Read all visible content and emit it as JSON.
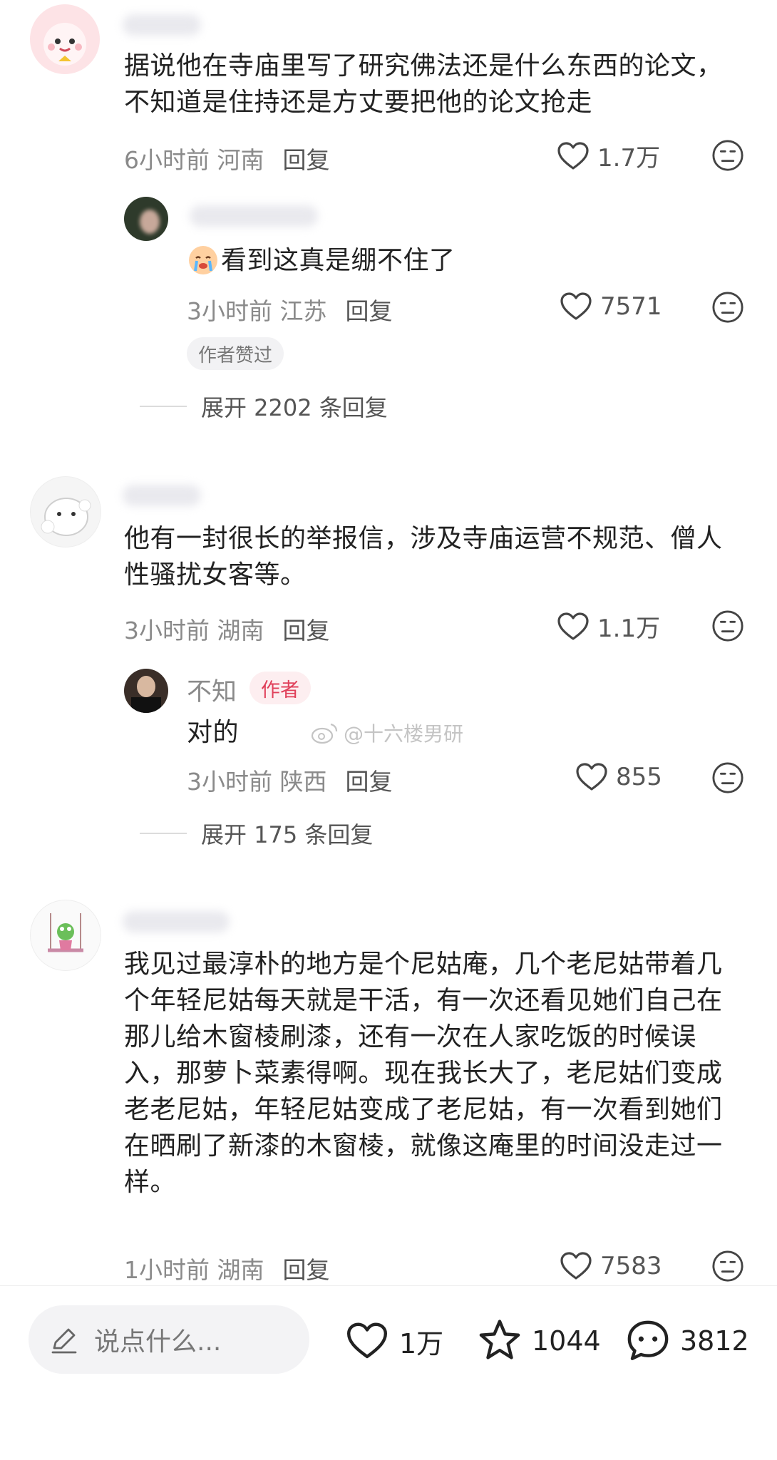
{
  "comments": [
    {
      "text_lines": [
        "据说他在寺庙里写了研究佛法还是什么东西的论文，",
        "不知道是住持还是方丈要把他的论文抢走"
      ],
      "time": "6小时前",
      "location": "河南",
      "reply_label": "回复",
      "likes": "1.7万"
    },
    {
      "text_lines": [
        "看到这真是绷不住了"
      ],
      "time": "3小时前",
      "location": "江苏",
      "reply_label": "回复",
      "likes": "7571",
      "badge": "作者赞过"
    },
    {
      "text_lines": [
        "他有一封很长的举报信，涉及寺庙运营不规范、僧人",
        "性骚扰女客等。"
      ],
      "time": "3小时前",
      "location": "湖南",
      "reply_label": "回复",
      "likes": "1.1万"
    },
    {
      "name": "不知",
      "author_tag": "作者",
      "text_lines": [
        "对的"
      ],
      "time": "3小时前",
      "location": "陕西",
      "reply_label": "回复",
      "likes": "855"
    },
    {
      "text_lines": [
        "我见过最淳朴的地方是个尼姑庵，几个老尼姑带着几",
        "个年轻尼姑每天就是干活，有一次还看见她们自己在",
        "那儿给木窗棱刷漆，还有一次在人家吃饭的时候误",
        "入，那萝卜菜素得啊。现在我长大了，老尼姑们变成",
        "老老尼姑，年轻尼姑变成了老尼姑，有一次看到她们",
        "在晒刷了新漆的木窗棱，就像这庵里的时间没走过一",
        "样。"
      ],
      "time": "1小时前",
      "location": "湖南",
      "reply_label": "回复",
      "likes": "7583"
    }
  ],
  "expand": [
    "展开 2202 条回复",
    "展开 175 条回复"
  ],
  "watermark": "@十六楼男研",
  "bottom_bar": {
    "placeholder": "说点什么...",
    "likes": "1万",
    "favorites": "1044",
    "comments": "3812"
  }
}
